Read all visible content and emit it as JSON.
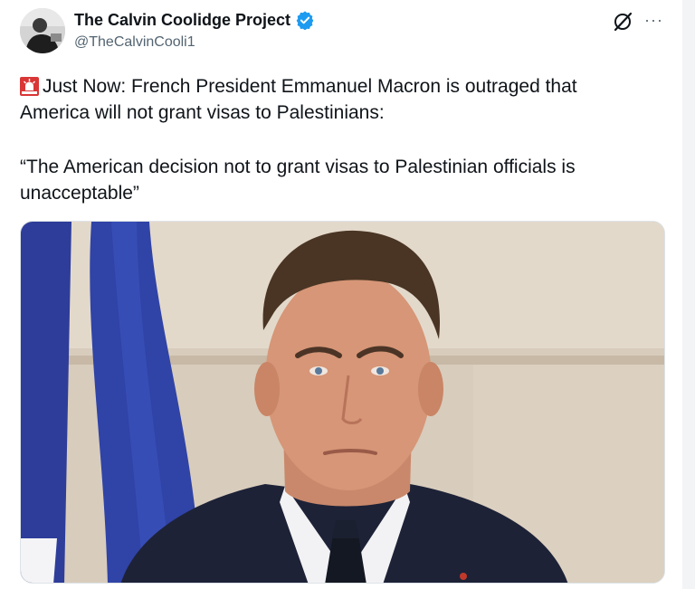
{
  "account": {
    "display_name": "The Calvin Coolidge Project",
    "handle": "@TheCalvinCooli1",
    "verified": true,
    "avatar_icon": "avatar-photo"
  },
  "tweet": {
    "line1": "Just Now: French President Emmanuel Macron is outraged that",
    "line2": "America will not grant visas to Palestinians:",
    "line3": "“The American decision not to grant visas to Palestinian officials is",
    "line4": "unacceptable”",
    "siren_icon": "police-light-emoji"
  },
  "actions": {
    "grok_icon": "grok-icon",
    "more_icon": "more-options-icon",
    "more_text": "···"
  },
  "colors": {
    "verified_blue": "#1d9bf0",
    "handle_gray": "#536471",
    "text": "#0f1419",
    "flag_blue": "#2e3d99"
  },
  "media": {
    "type": "photo",
    "alt_subject": "portrait-photo"
  }
}
